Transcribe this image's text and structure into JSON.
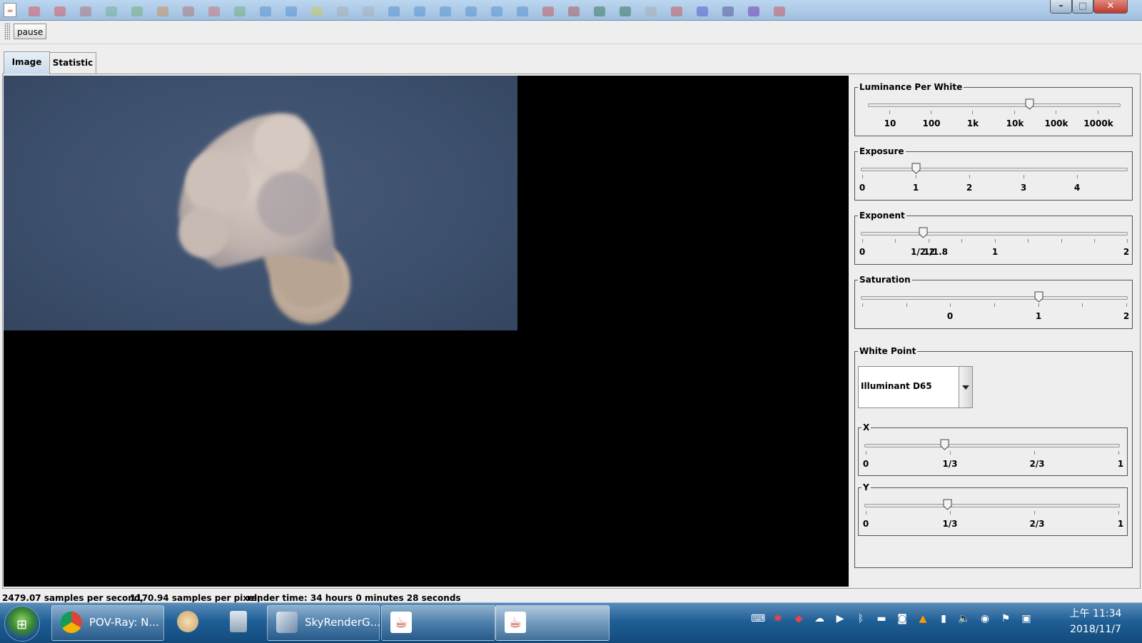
{
  "window": {
    "app_icon": "java-icon"
  },
  "toolbar": {
    "pause_label": "pause"
  },
  "tabs": [
    {
      "label": "Image"
    },
    {
      "label": "Statistic"
    }
  ],
  "controls": {
    "luminance": {
      "title": "Luminance Per White",
      "ticks": [
        "10",
        "100",
        "1k",
        "10k",
        "100k",
        "1000k"
      ],
      "value_fraction": 0.67
    },
    "exposure": {
      "title": "Exposure",
      "ticks": [
        "0",
        "1",
        "2",
        "3",
        "4"
      ],
      "value": 1
    },
    "exponent": {
      "title": "Exponent",
      "ticks": [
        "0",
        "1/2.2",
        "1/1.8",
        "1",
        "2"
      ],
      "value": 0.45
    },
    "saturation": {
      "title": "Saturation",
      "ticks": [
        "0",
        "1",
        "2"
      ],
      "value": 1
    },
    "white_point": {
      "title": "White Point",
      "selected": "Illuminant D65",
      "x": {
        "title": "X",
        "ticks": [
          "0",
          "1/3",
          "2/3",
          "1"
        ],
        "value": 0.3127
      },
      "y": {
        "title": "Y",
        "ticks": [
          "0",
          "1/3",
          "2/3",
          "1"
        ],
        "value": 0.329
      }
    }
  },
  "status": {
    "samples_per_second": "2479.07 samples per second,",
    "samples_per_pixel": "1170.94 samples per pixel,",
    "render_time": "render time: 34 hours 0 minutes 28 seconds"
  },
  "taskbar": {
    "items": [
      {
        "label": "POV-Ray: N...",
        "icon": "chrome-icon"
      },
      {
        "label": "",
        "icon": "paint-icon"
      },
      {
        "label": "",
        "icon": "calculator-icon"
      },
      {
        "label": "SkyRenderG...",
        "icon": "cube-icon"
      },
      {
        "label": "",
        "icon": "java-icon"
      },
      {
        "label": "",
        "icon": "java-icon"
      }
    ],
    "clock_time": "上午 11:34",
    "clock_date": "2018/11/7"
  }
}
